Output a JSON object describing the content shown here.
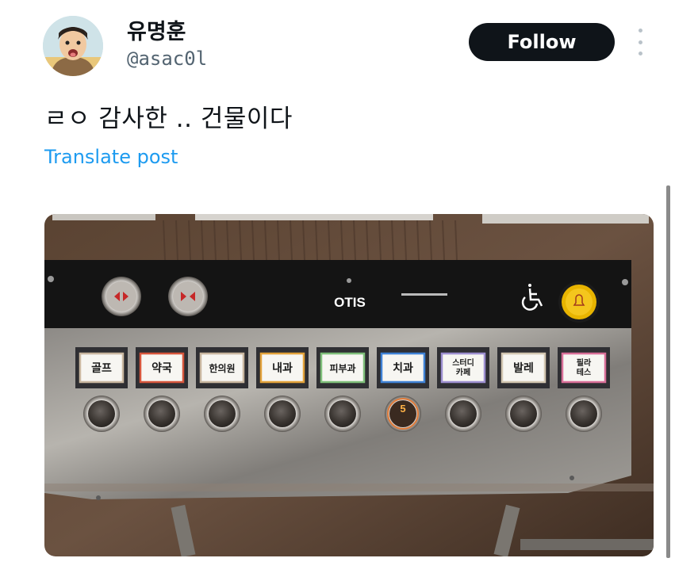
{
  "user": {
    "display_name": "유명훈",
    "handle": "@asac0l",
    "avatar_icon": "cartoon-avatar-icon"
  },
  "actions": {
    "follow_label": "Follow",
    "more_icon": "more-vertical-icon"
  },
  "post": {
    "text": "ㄹㅇ 감사한 .. 건물이다",
    "translate_label": "Translate post"
  },
  "photo": {
    "brand": "OTIS",
    "floor_labels": [
      "골프",
      "약국",
      "한의원",
      "내과",
      "피부과",
      "치과",
      "스터디\n카페",
      "발레",
      "필라\n테스"
    ],
    "lit_button_number": "5",
    "accessibility_icon": "wheelchair-icon",
    "alarm_icon": "bell-icon",
    "label_border_colors": [
      "#c9b7a0",
      "#d7563c",
      "#c9b7a0",
      "#e3a23a",
      "#7fbf7a",
      "#3f82d6",
      "#9d8fd0",
      "#d2c6b0",
      "#d96f98"
    ]
  },
  "colors": {
    "follow_bg": "#0f1419",
    "link": "#1d9bf0",
    "handle": "#536471"
  }
}
